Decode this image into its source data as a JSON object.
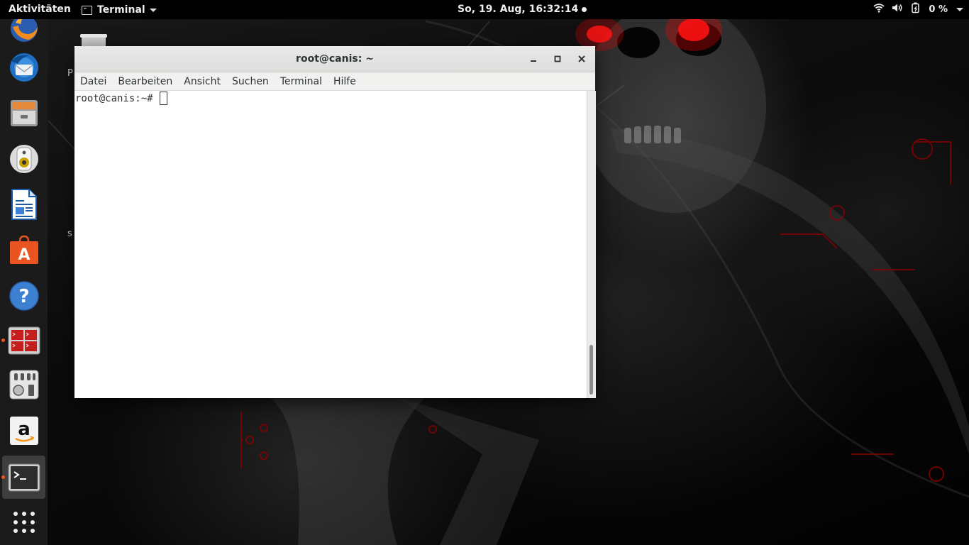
{
  "topbar": {
    "activities": "Aktivitäten",
    "app_menu_label": "Terminal",
    "clock": "So, 19. Aug, 16:32:14",
    "battery_percent": "0 %",
    "icons": [
      "wifi-icon",
      "volume-icon",
      "battery-icon",
      "dropdown-caret-icon"
    ]
  },
  "dock": {
    "items": [
      {
        "name": "firefox",
        "running": false
      },
      {
        "name": "thunderbird",
        "running": false
      },
      {
        "name": "files",
        "running": false
      },
      {
        "name": "rhythmbox",
        "running": false
      },
      {
        "name": "libreoffice-writer",
        "running": false
      },
      {
        "name": "ubuntu-software",
        "running": false
      },
      {
        "name": "help",
        "running": false
      },
      {
        "name": "terminal-split",
        "running": true
      },
      {
        "name": "settings",
        "running": false
      },
      {
        "name": "amazon",
        "running": false
      },
      {
        "name": "terminal",
        "running": true,
        "active": true
      },
      {
        "name": "show-applications",
        "running": false
      }
    ]
  },
  "desktop": {
    "labels": [
      "P",
      "s"
    ]
  },
  "window": {
    "title": "root@canis: ~",
    "menu": [
      "Datei",
      "Bearbeiten",
      "Ansicht",
      "Suchen",
      "Terminal",
      "Hilfe"
    ],
    "prompt": "root@canis:~# ",
    "scroll_position": 1.0
  },
  "colors": {
    "ubuntu_orange": "#e95420",
    "eye_red": "#ff1a1a",
    "window_bg": "#ffffff"
  }
}
